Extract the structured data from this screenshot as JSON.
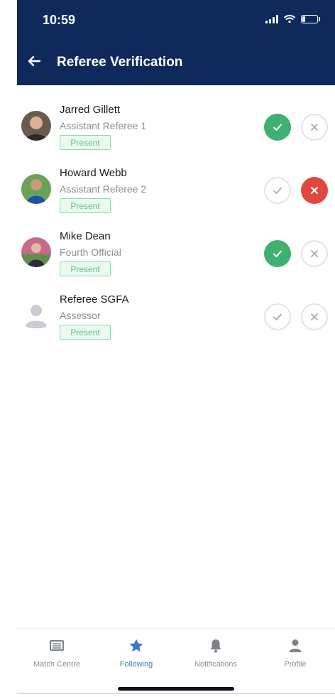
{
  "status_bar": {
    "time": "10:59"
  },
  "header": {
    "title": "Referee Verification",
    "back_icon": "arrow-left-icon"
  },
  "colors": {
    "header_bg": "#0f2a5a",
    "approve": "#3eb06f",
    "reject": "#e0483d",
    "badge": "#5fbf85",
    "active_tab": "#3f73d6"
  },
  "referees": [
    {
      "name": "Jarred Gillett",
      "role": "Assistant Referee 1",
      "status": "Present",
      "approval": "approved"
    },
    {
      "name": "Howard Webb",
      "role": "Assistant Referee 2",
      "status": "Present",
      "approval": "rejected"
    },
    {
      "name": "Mike Dean",
      "role": "Fourth Official",
      "status": "Present",
      "approval": "approved"
    },
    {
      "name": "Referee SGFA",
      "role": "Assessor",
      "status": "Present",
      "approval": "none"
    }
  ],
  "tabs": [
    {
      "label": "Match Centre",
      "icon": "match-centre-icon",
      "active": false
    },
    {
      "label": "Following",
      "icon": "star-icon",
      "active": true
    },
    {
      "label": "Notifications",
      "icon": "bell-icon",
      "active": false
    },
    {
      "label": "Profile",
      "icon": "profile-icon",
      "active": false
    }
  ]
}
